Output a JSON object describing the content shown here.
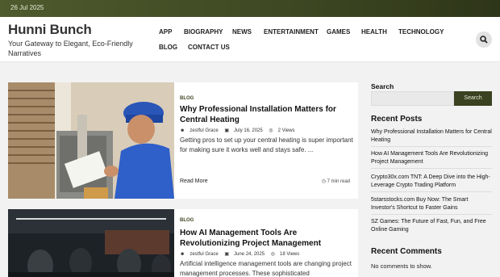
{
  "topbar": {
    "date": "26 Jul 2025"
  },
  "brand": {
    "title": "Hunni Bunch",
    "tagline": "Your Gateway to Elegant, Eco-Friendly Narratives"
  },
  "nav": {
    "items": [
      "APP",
      "BIOGRAPHY",
      "NEWS",
      "ENTERTAINMENT",
      "GAMES",
      "HEALTH",
      "TECHNOLOGY",
      "BLOG",
      "CONTACT US"
    ]
  },
  "posts": [
    {
      "category": "BLOG",
      "title": "Why Professional Installation Matters for Central Heating",
      "author": "zestful Grace",
      "date": "July 16, 2025",
      "views": "2 Views",
      "excerpt": "Getting pros to set up your central heating is super important for making sure it works well and stays safe. ...",
      "read_more": "Read More",
      "read_time": "7 min read"
    },
    {
      "category": "BLOG",
      "title": "How AI Management Tools Are Revolutionizing Project Management",
      "author": "zestful Grace",
      "date": "June 24, 2025",
      "views": "18 Views",
      "excerpt": "Artificial intelligence management tools are changing project management processes. These sophisticated"
    }
  ],
  "sidebar": {
    "search_label": "Search",
    "search_button": "Search",
    "recent_posts_heading": "Recent Posts",
    "recent_posts": [
      "Why Professional Installation Matters for Central Heating",
      "How AI Management Tools Are Revolutionizing Project Management",
      "Crypto30x.com TNT: A Deep Dive into the High-Leverage Crypto Trading Platform",
      "5starsstocks.com Buy Now: The Smart Investor's Shortcut to Faster Gains",
      "SZ Games: The Future of Fast, Fun, and Free Online Gaming"
    ],
    "recent_comments_heading": "Recent Comments",
    "no_comments": "No comments to show."
  },
  "icons": {
    "search": "search-icon",
    "author": "user-icon",
    "date": "calendar-icon",
    "views": "eye-icon",
    "read_time": "clock-icon"
  },
  "colors": {
    "accent": "#3b4221",
    "topbar": "#4f5a2d"
  }
}
